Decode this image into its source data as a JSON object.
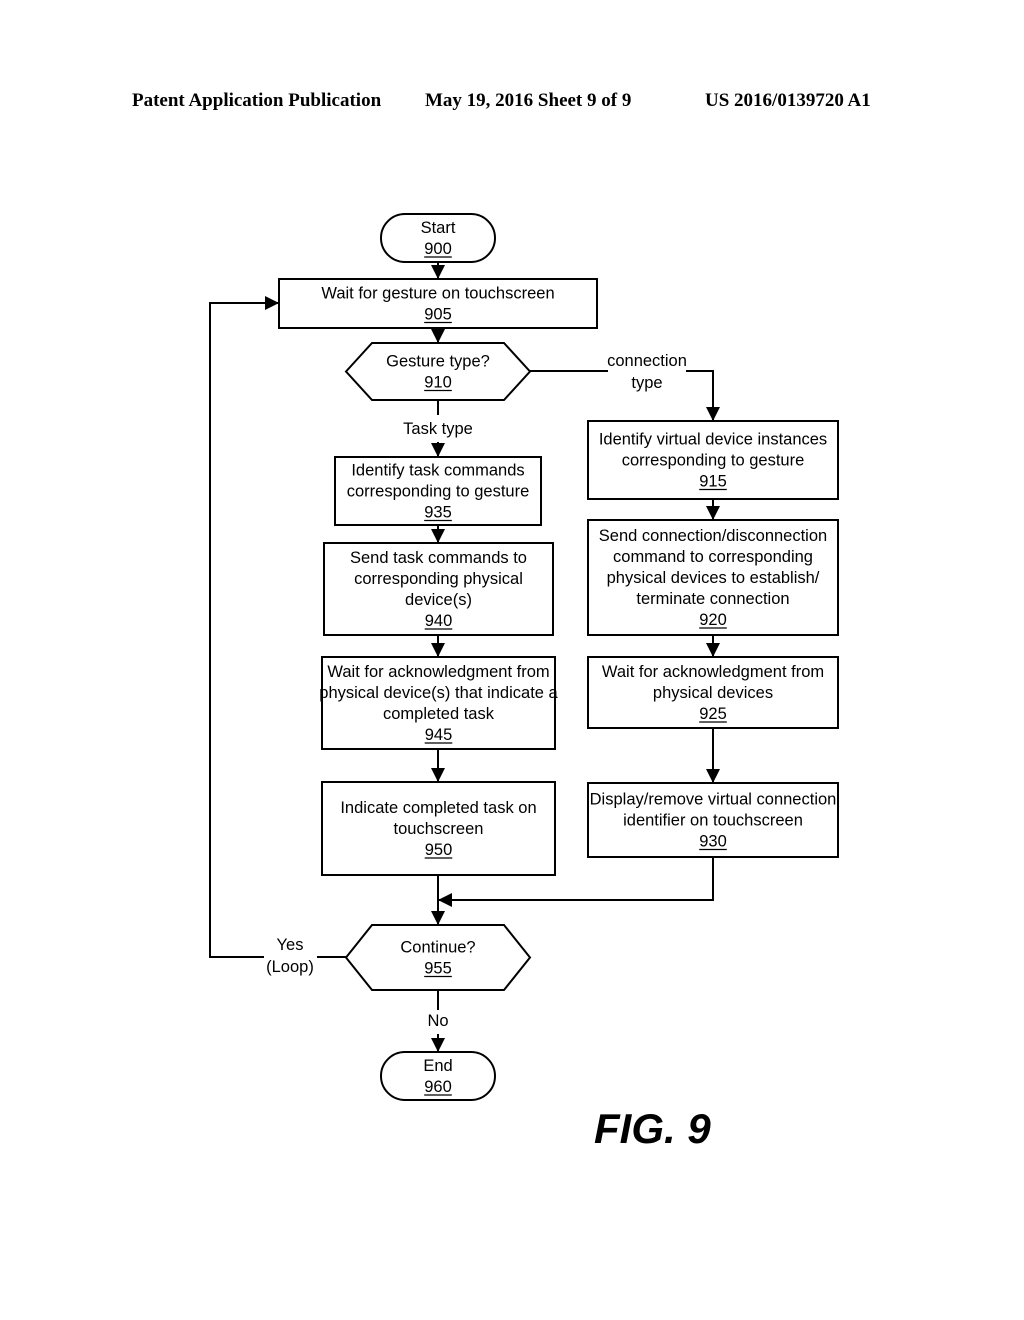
{
  "header": {
    "publication": "Patent Application Publication",
    "date_sheet": "May 19, 2016  Sheet 9 of 9",
    "number": "US 2016/0139720 A1"
  },
  "figure_label": "FIG. 9",
  "nodes": {
    "start": {
      "lines": [
        "Start"
      ],
      "ref": "900"
    },
    "n905": {
      "lines": [
        "Wait for gesture on touchscreen"
      ],
      "ref": "905"
    },
    "n910": {
      "lines": [
        "Gesture type?"
      ],
      "ref": "910"
    },
    "n915": {
      "lines": [
        "Identify virtual device instances",
        "corresponding to gesture"
      ],
      "ref": "915"
    },
    "n920": {
      "lines": [
        "Send connection/disconnection",
        "command to corresponding",
        "physical devices to establish/",
        "terminate connection"
      ],
      "ref": "920"
    },
    "n925": {
      "lines": [
        "Wait for acknowledgment from",
        "physical devices"
      ],
      "ref": "925"
    },
    "n930": {
      "lines": [
        "Display/remove virtual connection",
        "identifier on touchscreen"
      ],
      "ref": "930"
    },
    "n935": {
      "lines": [
        "Identify task commands",
        "corresponding to gesture"
      ],
      "ref": "935"
    },
    "n940": {
      "lines": [
        "Send task commands to",
        "corresponding physical",
        "device(s)"
      ],
      "ref": "940"
    },
    "n945": {
      "lines": [
        "Wait for acknowledgment from",
        "physical device(s) that indicate a",
        "completed task"
      ],
      "ref": "945"
    },
    "n950": {
      "lines": [
        "Indicate completed task on",
        "touchscreen"
      ],
      "ref": "950"
    },
    "n955": {
      "lines": [
        "Continue?"
      ],
      "ref": "955"
    },
    "end": {
      "lines": [
        "End"
      ],
      "ref": "960"
    }
  },
  "edge_labels": {
    "connection_type": [
      "connection",
      "type"
    ],
    "task_type": [
      "Task type"
    ],
    "yes_loop": [
      "Yes",
      "(Loop)"
    ],
    "no": [
      "No"
    ]
  }
}
